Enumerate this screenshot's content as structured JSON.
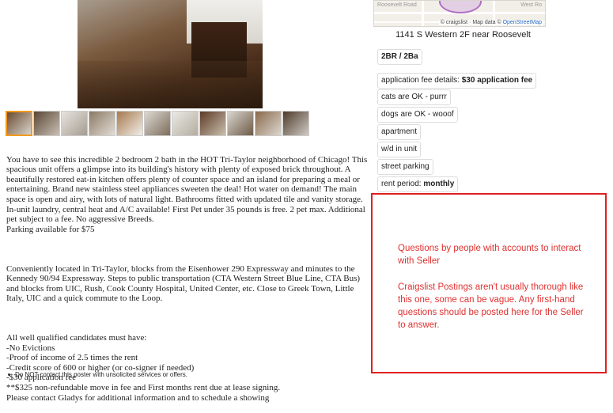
{
  "gallery": {
    "thumbnails": [
      {
        "color_a": "#6b4a30",
        "color_b": "#d9d4cc"
      },
      {
        "color_a": "#5a4636",
        "color_b": "#c9c1b4"
      },
      {
        "color_a": "#e7e4de",
        "color_b": "#a59c90"
      },
      {
        "color_a": "#8c7a66",
        "color_b": "#e2ddd4"
      },
      {
        "color_a": "#a77a4e",
        "color_b": "#f1efe9"
      },
      {
        "color_a": "#dcd9d2",
        "color_b": "#7d6d5c"
      },
      {
        "color_a": "#ebe9e4",
        "color_b": "#b4aca0"
      },
      {
        "color_a": "#5c3b26",
        "color_b": "#cbbfae"
      },
      {
        "color_a": "#d9d6cf",
        "color_b": "#6e5a46"
      },
      {
        "color_a": "#8a6a4c",
        "color_b": "#dcd7cf"
      },
      {
        "color_a": "#4e3a2b",
        "color_b": "#d0cbc3"
      }
    ]
  },
  "description": {
    "paragraphs": [
      "You have to see this incredible 2 bedroom 2 bath in the HOT Tri-Taylor neighborhood of Chicago! This spacious unit offers a glimpse into its building's history with plenty of exposed brick throughout. A beautifully restored eat-in kitchen offers plenty of counter space and an island for preparing a meal or entertaining. Brand new stainless steel appliances sweeten the deal! Hot water on demand! The main space is open and airy, with lots of natural light. Bathrooms fitted with updated tile and vanity storage. In-unit laundry, central heat and A/C available! First Pet under 35 pounds is free. 2 pet max. Additional pet subject to a fee. No aggressive Breeds.\nParking available for $75",
      "Conveniently located in Tri-Taylor, blocks from the Eisenhower 290 Expressway and minutes to the Kennedy 90/94 Expressway. Steps to public transportation (CTA Western Street Blue Line, CTA Bus) and blocks from UIC, Rush, Cook County Hospital, United Center, etc. Close to Greek Town, Little Italy, UIC and a quick commute to the Loop.",
      "All well qualified candidates must have:\n-No Evictions\n-Proof of income of 2.5 times the rent\n-Credit score of 600 or higher (or co-signer if needed)\n-$30 application fee\n**$325 non-refundable move in fee and First months rent due at lease signing.\nPlease contact Gladys for additional information and to schedule a showing"
    ],
    "notice": "Do NOT contact this poster with unsolicited services or offers."
  },
  "map": {
    "street_label_left": "Roosevelt Road",
    "street_label_right": "West Ro",
    "attribution_prefix": "© craigslist · Map data ©",
    "attribution_link": "OpenStreetMap"
  },
  "address": "1141 S Western 2F near Roosevelt",
  "attributes": {
    "bed_bath": "2BR / 2Ba",
    "app_fee_label": "application fee details:",
    "app_fee_value": "$30 application fee",
    "cats": "cats are OK - purrr",
    "dogs": "dogs are OK - wooof",
    "housing_type": "apartment",
    "laundry": "w/d in unit",
    "parking": "street parking",
    "rent_period_label": "rent period:",
    "rent_period_value": "monthly"
  },
  "annotation": {
    "line1": "Questions by people with accounts to interact with Seller",
    "line2": "Craigslist Postings aren't usually thorough like this one, some can be vague. Any first-hand questions should be posted here for the Seller to answer."
  },
  "colors": {
    "annotation_red": "#e02020",
    "thumb_active": "#f29b1d",
    "link": "#2a6bc2"
  }
}
